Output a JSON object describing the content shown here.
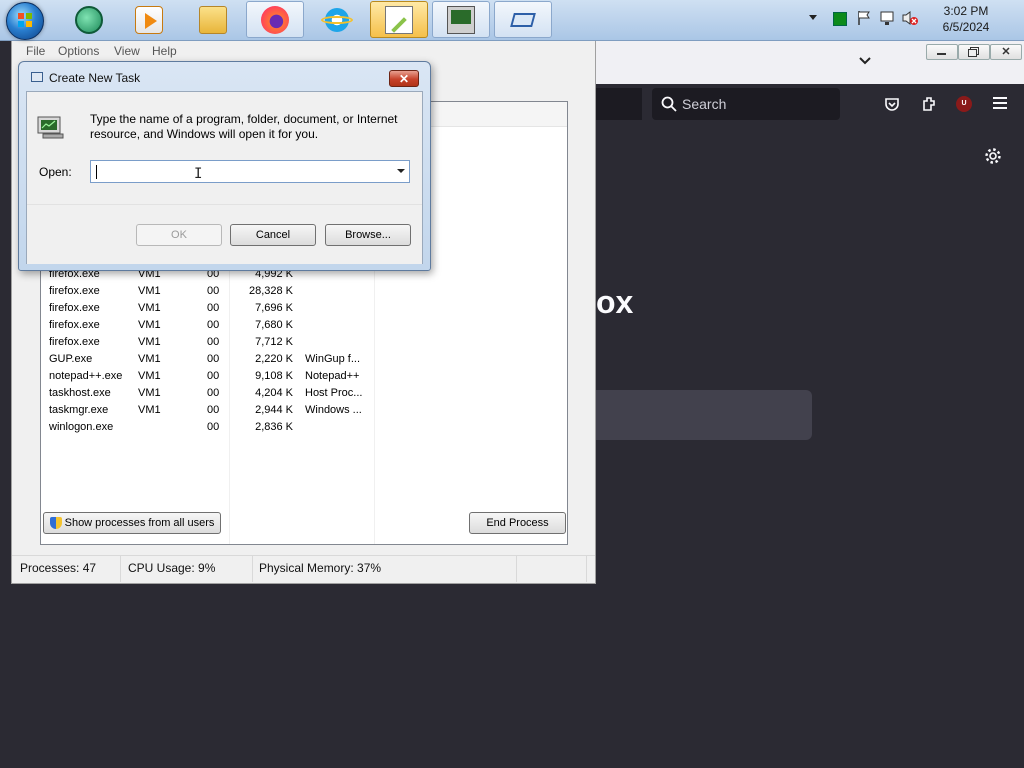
{
  "taskbar": {
    "start": "start-orb",
    "buttons": [
      {
        "name": "media-center",
        "icon": "media-center-icon"
      },
      {
        "name": "media-player",
        "icon": "media-player-icon"
      },
      {
        "name": "file-explorer",
        "icon": "folder-icon"
      },
      {
        "name": "firefox",
        "icon": "firefox-icon"
      },
      {
        "name": "internet-explorer",
        "icon": "ie-icon"
      },
      {
        "name": "notepad-plus-plus",
        "icon": "notepad-plus-plus-icon"
      },
      {
        "name": "task-manager",
        "icon": "task-manager-icon"
      },
      {
        "name": "remote-desktop",
        "icon": "remote-icon"
      }
    ],
    "clock": {
      "time": "3:02 PM",
      "date": "6/5/2024"
    }
  },
  "firefox": {
    "search_label": "Search",
    "brand_fragment": "ox"
  },
  "task_manager": {
    "menu": [
      "File",
      "Options",
      "View",
      "Help"
    ],
    "processes": [
      {
        "name": "firefox.exe",
        "user": "VM1",
        "cpu": "00",
        "memory": "4,992 K",
        "description": ""
      },
      {
        "name": "firefox.exe",
        "user": "VM1",
        "cpu": "00",
        "memory": "28,328 K",
        "description": ""
      },
      {
        "name": "firefox.exe",
        "user": "VM1",
        "cpu": "00",
        "memory": "7,696 K",
        "description": ""
      },
      {
        "name": "firefox.exe",
        "user": "VM1",
        "cpu": "00",
        "memory": "7,680 K",
        "description": ""
      },
      {
        "name": "firefox.exe",
        "user": "VM1",
        "cpu": "00",
        "memory": "7,712 K",
        "description": ""
      },
      {
        "name": "GUP.exe",
        "user": "VM1",
        "cpu": "00",
        "memory": "2,220 K",
        "description": "WinGup f..."
      },
      {
        "name": "notepad++.exe",
        "user": "VM1",
        "cpu": "00",
        "memory": "9,108 K",
        "description": "Notepad++"
      },
      {
        "name": "taskhost.exe",
        "user": "VM1",
        "cpu": "00",
        "memory": "4,204 K",
        "description": "Host Proc..."
      },
      {
        "name": "taskmgr.exe",
        "user": "VM1",
        "cpu": "00",
        "memory": "2,944 K",
        "description": "Windows ..."
      },
      {
        "name": "winlogon.exe",
        "user": "",
        "cpu": "00",
        "memory": "2,836 K",
        "description": ""
      }
    ],
    "show_all_label": "Show processes from all users",
    "end_process_label": "End Process",
    "status": {
      "processes": "Processes: 47",
      "cpu": "CPU Usage: 9%",
      "memory": "Physical Memory: 37%"
    }
  },
  "dialog": {
    "title": "Create New Task",
    "description": "Type the name of a program, folder, document, or Internet resource, and Windows will open it for you.",
    "open_label": "Open:",
    "open_value": "",
    "ok_label": "OK",
    "cancel_label": "Cancel",
    "browse_label": "Browse..."
  },
  "colors": {
    "taskbar": "#b9d1ec",
    "firefox_dark": "#2b2a33",
    "dialog_frame": "#c2d6ec",
    "close_red": "#c7422a"
  }
}
